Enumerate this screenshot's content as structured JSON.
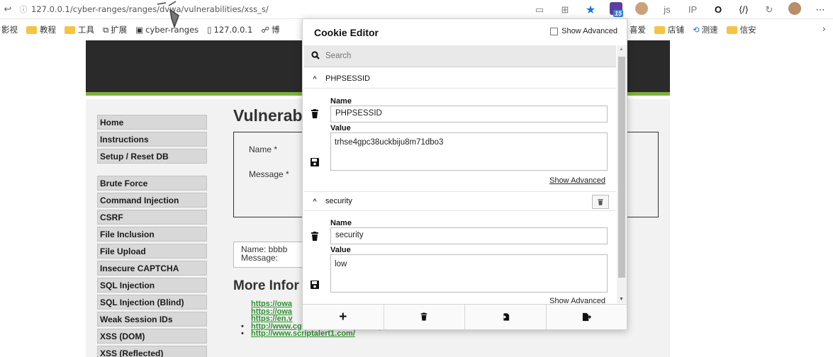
{
  "browser": {
    "url": "127.0.0.1/cyber-ranges/ranges/dvwa/vulnerabilities/xss_s/",
    "badge_count": "15",
    "bookmarks": [
      {
        "label": "影视",
        "folder": false
      },
      {
        "label": "教程",
        "folder": true
      },
      {
        "label": "工具",
        "folder": true
      },
      {
        "label": "扩展",
        "folder": false
      },
      {
        "label": "cyber-ranges",
        "folder": false
      },
      {
        "label": "127.0.0.1",
        "folder": false
      },
      {
        "label": "博",
        "folder": false
      }
    ],
    "bookmarks_right": [
      {
        "label": "喜爱",
        "folder": false
      },
      {
        "label": "店铺",
        "folder": true
      },
      {
        "label": "测速",
        "folder": false
      },
      {
        "label": "信安",
        "folder": true
      }
    ]
  },
  "dvwa": {
    "menu": [
      "Home",
      "Instructions",
      "Setup / Reset DB",
      "",
      "Brute Force",
      "Command Injection",
      "CSRF",
      "File Inclusion",
      "File Upload",
      "Insecure CAPTCHA",
      "SQL Injection",
      "SQL Injection (Blind)",
      "Weak Session IDs",
      "XSS (DOM)",
      "XSS (Reflected)"
    ],
    "title": "Vulnerab",
    "form": {
      "name_label": "Name *",
      "message_label": "Message *"
    },
    "result": {
      "name": "Name: bbbb",
      "message": "Message:"
    },
    "more_info_title": "More Infor",
    "links": [
      "https://owa",
      "https://owa",
      "https://en.v",
      "http://www.cgisecurity.com/xss-faq.html",
      "http://www.scriptalert1.com/"
    ]
  },
  "cookie_editor": {
    "title": "Cookie Editor",
    "show_advanced": "Show Advanced",
    "search_placeholder": "Search",
    "cookies": [
      {
        "name": "PHPSESSID",
        "name_label": "Name",
        "value_label": "Value",
        "value": "trhse4gpc38uckbiju8m71dbo3",
        "show_advanced": "Show Advanced"
      },
      {
        "name": "security",
        "name_label": "Name",
        "value_label": "Value",
        "value": "low",
        "show_advanced": "Show Advanced"
      }
    ],
    "toolbar": [
      "add-icon",
      "delete-all-icon",
      "import-icon",
      "export-icon"
    ]
  }
}
